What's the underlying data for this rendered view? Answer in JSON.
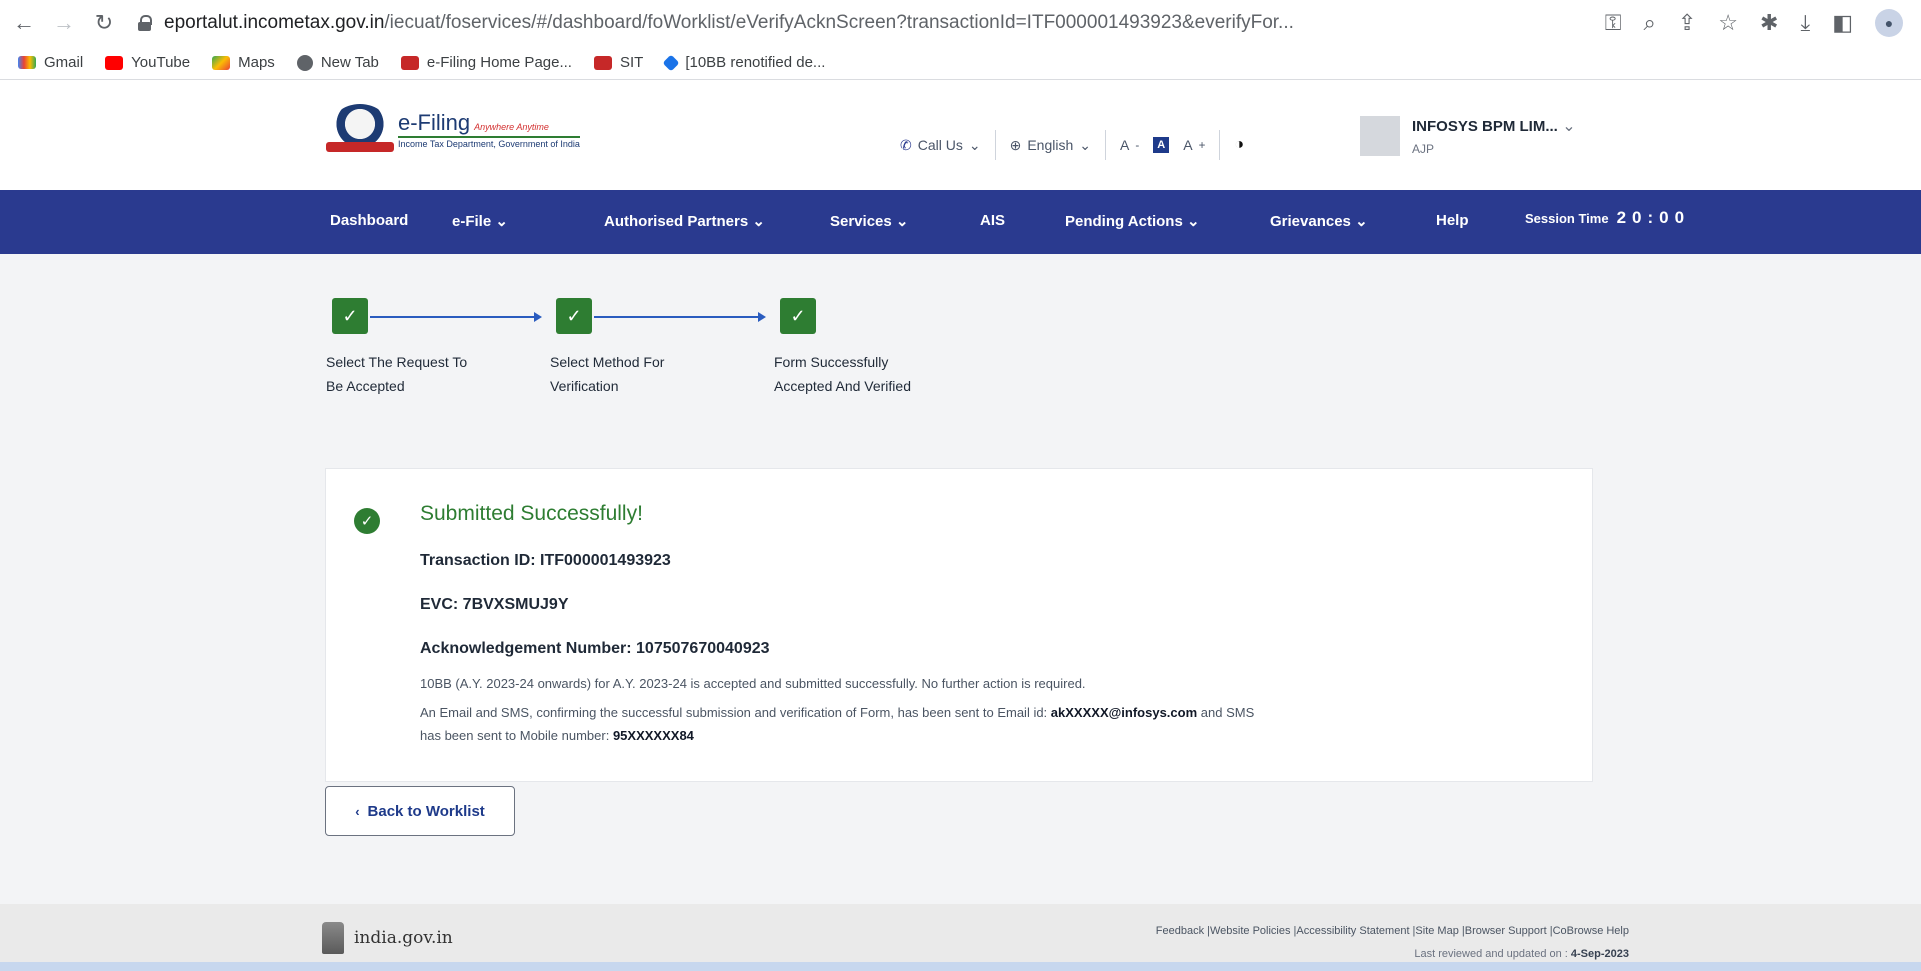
{
  "browser": {
    "url_host": "eportalut.incometax.gov.in",
    "url_path": "/iecuat/foservices/#/dashboard/foWorklist/eVerifyAcknScreen?transactionId=ITF000001493923&everifyFor...",
    "bookmarks": [
      "Gmail",
      "YouTube",
      "Maps",
      "New Tab",
      "e-Filing Home Page...",
      "SIT",
      "[10BB renotified de..."
    ]
  },
  "header": {
    "logo_title": "e-Filing",
    "logo_tagline": "Anywhere Anytime",
    "logo_sub": "Income Tax Department, Government of India",
    "call_us": "Call Us",
    "language": "English",
    "font_small": "A",
    "font_normal": "A",
    "font_large": "A",
    "user_name": "INFOSYS BPM LIM...",
    "user_sub": "AJP"
  },
  "nav": {
    "items": [
      "Dashboard",
      "e-File",
      "Authorised Partners",
      "Services",
      "AIS",
      "Pending Actions",
      "Grievances",
      "Help"
    ],
    "session_label": "Session Time",
    "session_time": "20:00"
  },
  "stepper": {
    "steps": [
      {
        "label_line1": "Select The Request To",
        "label_line2": "Be Accepted"
      },
      {
        "label_line1": "Select Method For",
        "label_line2": "Verification"
      },
      {
        "label_line1": "Form Successfully",
        "label_line2": "Accepted And Verified"
      }
    ]
  },
  "result": {
    "title": "Submitted Successfully!",
    "transaction_label": "Transaction ID: ",
    "transaction_id": "ITF000001493923",
    "evc_label": "EVC: ",
    "evc": "7BVXSMUJ9Y",
    "ack_label": "Acknowledgement Number: ",
    "ack_number": "107507670040923",
    "note1": "10BB (A.Y. 2023-24 onwards) for A.Y. 2023-24 is accepted and submitted successfully. No further action is required.",
    "note2_prefix": "An Email and SMS, confirming the successful submission and verification of Form, has been sent to Email id: ",
    "email": "akXXXXX@infosys.com",
    "note2_mid": " and SMS",
    "note3_prefix": "has been sent to Mobile number: ",
    "mobile": "95XXXXXX84"
  },
  "back_button": "Back to Worklist",
  "footer": {
    "gov_text": "india.gov.in",
    "links": "Feedback |Website Policies |Accessibility Statement |Site Map |Browser Support |CoBrowse Help",
    "updated_label": "Last reviewed and updated on : ",
    "updated_date": "4-Sep-2023"
  },
  "colors": {
    "nav_bg": "#2a3a8f",
    "success_green": "#2e7d32",
    "link_blue": "#1e3a8a"
  }
}
